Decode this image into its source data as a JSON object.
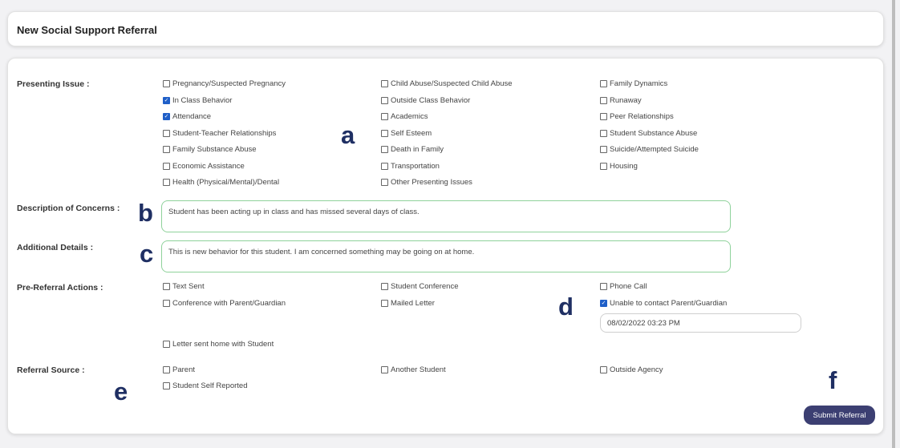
{
  "header": {
    "title": "New Social Support Referral"
  },
  "presenting_issue": {
    "label": "Presenting Issue :",
    "items": [
      {
        "label": "Pregnancy/Suspected Pregnancy",
        "checked": false
      },
      {
        "label": "Child Abuse/Suspected Child Abuse",
        "checked": false
      },
      {
        "label": "Family Dynamics",
        "checked": false
      },
      {
        "label": "In Class Behavior",
        "checked": true
      },
      {
        "label": "Outside Class Behavior",
        "checked": false
      },
      {
        "label": "Runaway",
        "checked": false
      },
      {
        "label": "Attendance",
        "checked": true
      },
      {
        "label": "Academics",
        "checked": false
      },
      {
        "label": "Peer Relationships",
        "checked": false
      },
      {
        "label": "Student-Teacher Relationships",
        "checked": false
      },
      {
        "label": "Self Esteem",
        "checked": false
      },
      {
        "label": "Student Substance Abuse",
        "checked": false
      },
      {
        "label": "Family Substance Abuse",
        "checked": false
      },
      {
        "label": "Death in Family",
        "checked": false
      },
      {
        "label": "Suicide/Attempted Suicide",
        "checked": false
      },
      {
        "label": "Economic Assistance",
        "checked": false
      },
      {
        "label": "Transportation",
        "checked": false
      },
      {
        "label": "Housing",
        "checked": false
      },
      {
        "label": "Health (Physical/Mental)/Dental",
        "checked": false
      },
      {
        "label": "Other Presenting Issues",
        "checked": false
      }
    ]
  },
  "description": {
    "label": "Description of Concerns :",
    "value": "Student has been acting up in class and has missed several days of class."
  },
  "additional": {
    "label": "Additional Details :",
    "value": "This is new behavior for this student.  I am concerned something may be going on at home."
  },
  "pre_referral": {
    "label": "Pre-Referral Actions :",
    "items": [
      {
        "label": "Text Sent",
        "checked": false
      },
      {
        "label": "Student Conference",
        "checked": false
      },
      {
        "label": "Phone Call",
        "checked": false
      },
      {
        "label": "Conference with Parent/Guardian",
        "checked": false
      },
      {
        "label": "Mailed Letter",
        "checked": false
      },
      {
        "label": "Unable to contact Parent/Guardian",
        "checked": true
      },
      {
        "label": "Letter sent home with Student",
        "checked": false
      }
    ],
    "date_value": "08/02/2022 03:23 PM"
  },
  "referral_source": {
    "label": "Referral Source :",
    "items": [
      {
        "label": "Parent",
        "checked": false
      },
      {
        "label": "Another Student",
        "checked": false
      },
      {
        "label": "Outside Agency",
        "checked": false
      },
      {
        "label": "Student Self Reported",
        "checked": false
      }
    ]
  },
  "submit": {
    "label": "Submit Referral"
  },
  "callouts": [
    "a",
    "b",
    "c",
    "d",
    "e",
    "f"
  ],
  "colors": {
    "accent": "#3c3f72",
    "textarea_border": "#8fd29b",
    "checkbox_checked": "#1f5fc8",
    "callout": "#1f2f63"
  }
}
